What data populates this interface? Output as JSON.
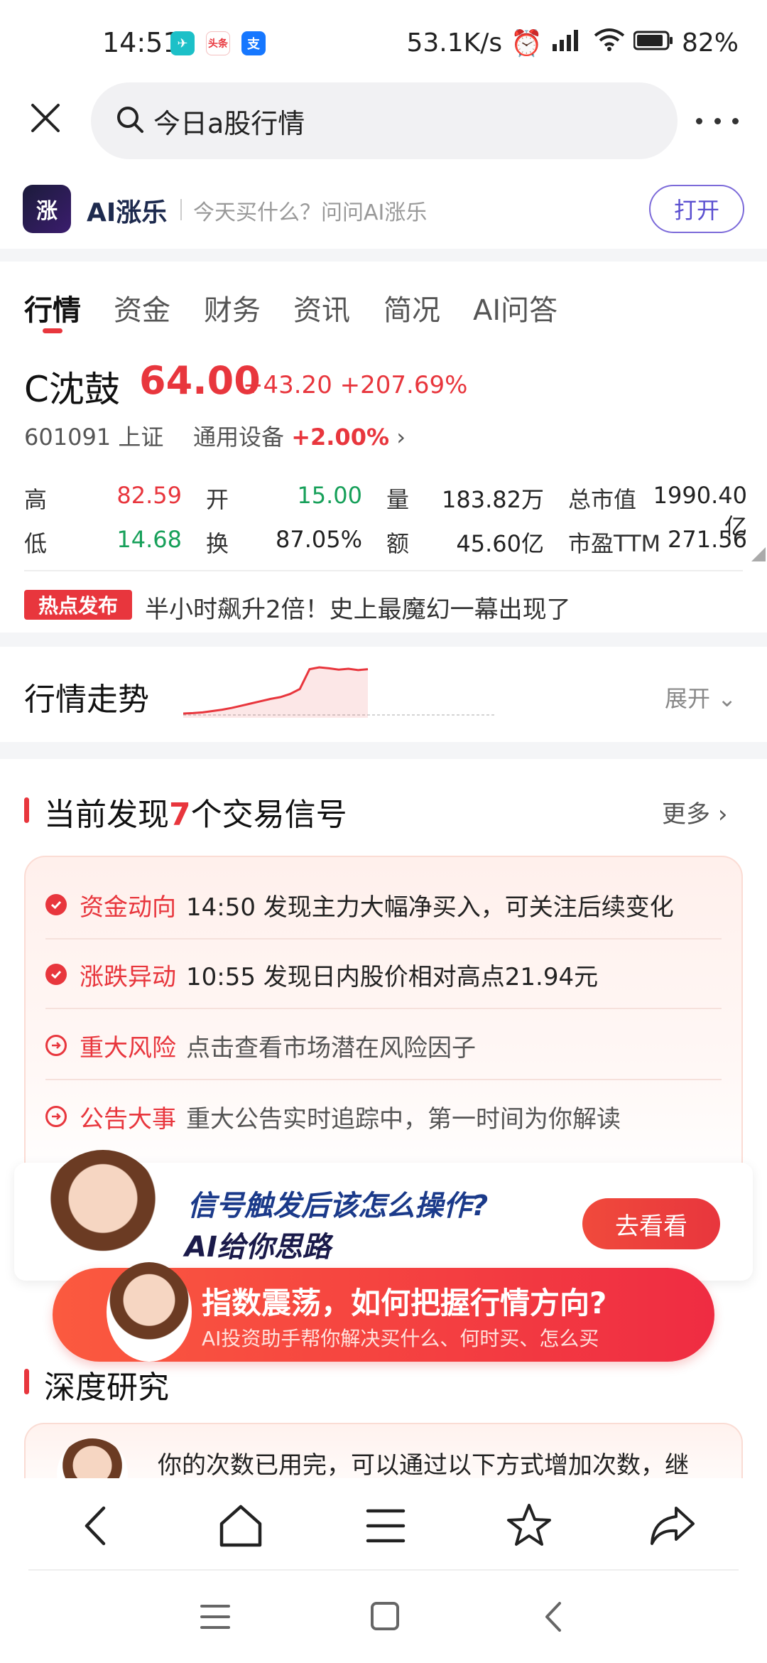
{
  "status_bar": {
    "time": "14:51",
    "network_speed": "53.1K/s",
    "battery": "82%",
    "app_icons": [
      "telegram-icon",
      "toutiao-icon",
      "alipay-icon"
    ]
  },
  "search": {
    "query": "今日a股行情"
  },
  "app_banner": {
    "name": "AI涨乐",
    "slogan": "今天买什么？问问AI涨乐",
    "open_label": "打开",
    "logo_text": "涨"
  },
  "tabs": [
    {
      "label": "行情",
      "active": true
    },
    {
      "label": "资金",
      "active": false
    },
    {
      "label": "财务",
      "active": false
    },
    {
      "label": "资讯",
      "active": false
    },
    {
      "label": "简况",
      "active": false
    },
    {
      "label": "AI问答",
      "active": false
    }
  ],
  "stock": {
    "name": "C沈鼓",
    "price": "64.00",
    "change": "+43.20 +207.69%",
    "code": "601091 上证",
    "sector_name": "通用设备",
    "sector_change": "+2.00%",
    "quote": [
      {
        "label": "高",
        "value": "82.59"
      },
      {
        "label": "开",
        "value": "15.00"
      },
      {
        "label": "量",
        "value": "183.82万"
      },
      {
        "label": "总市值",
        "value": "1990.40亿"
      },
      {
        "label": "低",
        "value": "14.68"
      },
      {
        "label": "换",
        "value": "87.05%"
      },
      {
        "label": "额",
        "value": "45.60亿"
      },
      {
        "label": "市盈TTM",
        "value": "271.56"
      }
    ]
  },
  "hot_news": {
    "badge": "热点发布",
    "text": "半小时飙升2倍！史上最魔幻一幕出现了"
  },
  "trend": {
    "title": "行情走势",
    "expand_label": "展开"
  },
  "signals": {
    "title_prefix": "当前发现",
    "count": "7",
    "title_suffix": "个交易信号",
    "more_label": "更多",
    "items": [
      {
        "label": "资金动向",
        "text": "14:50 发现主力大幅净买入，可关注后续变化",
        "icon": "check-circle-icon"
      },
      {
        "label": "涨跌异动",
        "text": "10:55 发现日内股价相对高点21.94元",
        "icon": "check-circle-icon"
      },
      {
        "label": "重大风险",
        "text": "点击查看市场潜在风险因子",
        "icon": "arrow-circle-icon"
      },
      {
        "label": "公告大事",
        "text": "重大公告实时追踪中，第一时间为你解读",
        "icon": "arrow-circle-icon"
      }
    ]
  },
  "promo_card": {
    "question": "信号触发后该怎么操作?",
    "answer": "AI给你思路",
    "button": "去看看"
  },
  "promo_banner": {
    "title": "指数震荡，如何把握行情方向?",
    "subtitle": "AI投资助手帮你解决买什么、何时买、怎么买"
  },
  "research": {
    "title": "深度研究",
    "text": "你的次数已用完，可以通过以下方式增加次数，继"
  },
  "colors": {
    "accent_red": "#e8363d",
    "green": "#17a05a",
    "brand_purple": "#5a4fd0"
  },
  "chart_data": {
    "type": "line",
    "series": [
      {
        "values": [
          14.7,
          15.2,
          16.0,
          17.5,
          19.0,
          21.0,
          23.5,
          26.0,
          28.5,
          31.0,
          33.0,
          36.5,
          42.0,
          64.0,
          66.0,
          65.0,
          63.5,
          64.5,
          63.0,
          64.0
        ]
      }
    ],
    "title": "",
    "xlabel": "",
    "ylabel": ""
  }
}
